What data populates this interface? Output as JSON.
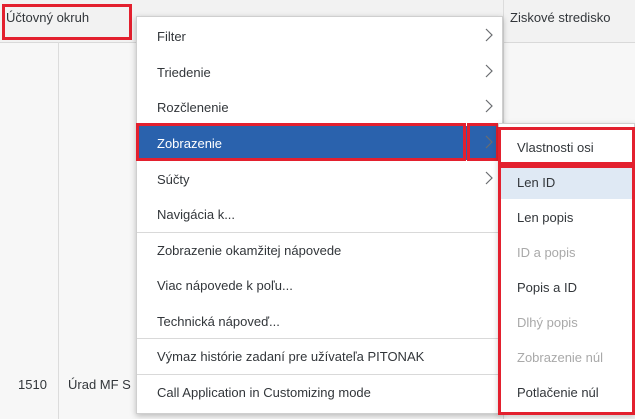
{
  "table": {
    "columns": [
      "Účtovný okruh",
      "Ziskové stredisko"
    ],
    "row": {
      "okruh": "1510",
      "name": "Úrad MF S"
    }
  },
  "menu": {
    "items": [
      {
        "label": "Filter",
        "submenu": true
      },
      {
        "label": "Triedenie",
        "submenu": true
      },
      {
        "label": "Rozčlenenie",
        "submenu": true
      },
      {
        "label": "Zobrazenie",
        "submenu": true,
        "selected": true
      },
      {
        "label": "Súčty",
        "submenu": true
      },
      {
        "label": "Navigácia k...",
        "submenu": false
      },
      {
        "label": "Zobrazenie okamžitej nápovede",
        "submenu": false
      },
      {
        "label": "Viac nápovede k poľu...",
        "submenu": false
      },
      {
        "label": "Technická nápoveď...",
        "submenu": false
      },
      {
        "label": "Výmaz histórie zadaní pre užívateľa PITONAK",
        "submenu": false
      },
      {
        "label": "Call Application in Customizing mode",
        "submenu": false
      }
    ]
  },
  "submenu": {
    "items": [
      {
        "label": "Vlastnosti osi",
        "enabled": true
      },
      {
        "label": "Len ID",
        "enabled": true,
        "selected": true
      },
      {
        "label": "Len popis",
        "enabled": true
      },
      {
        "label": "ID a popis",
        "enabled": false
      },
      {
        "label": "Popis a ID",
        "enabled": true
      },
      {
        "label": "Dlhý popis",
        "enabled": false
      },
      {
        "label": "Zobrazenie núl",
        "enabled": false
      },
      {
        "label": "Potlačenie núl",
        "enabled": true
      }
    ]
  },
  "colors": {
    "selected_bg": "#2a62ad",
    "highlight": "#e3202e"
  }
}
